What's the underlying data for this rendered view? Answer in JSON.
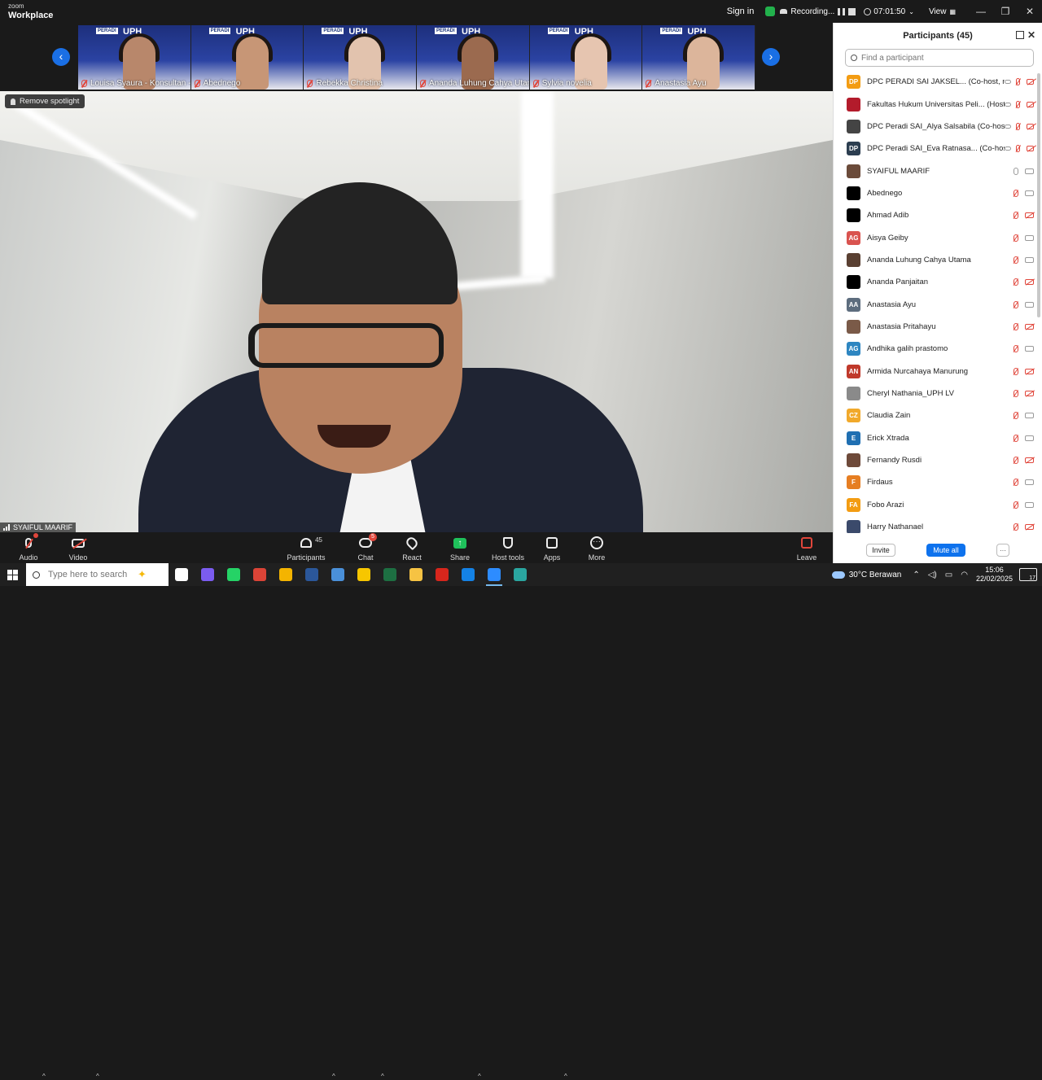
{
  "app": {
    "brand_small": "zoom",
    "brand_name": "Workplace"
  },
  "titlebar": {
    "sign_in": "Sign in",
    "recording": "Recording...",
    "timer": "07:01:50",
    "view": "View",
    "minimize": "—",
    "restore": "❐",
    "close": "✕"
  },
  "thumbnails": [
    {
      "name": "Louisa Syaura - Konsultan -...",
      "logo": "PERADI",
      "org": "UPH",
      "skin": "#b8876b"
    },
    {
      "name": "Abednego",
      "logo": "PERADI",
      "org": "UPH",
      "skin": "#c79676"
    },
    {
      "name": "Rebekka Christina",
      "logo": "PERADI",
      "org": "UPH",
      "skin": "#e2c3ae"
    },
    {
      "name": "Ananda Luhung Cahya Utama",
      "logo": "PERADI",
      "org": "UPH",
      "skin": "#9b6a4f"
    },
    {
      "name": "Sylvia novelia",
      "logo": "PERADI",
      "org": "UPH",
      "skin": "#e6c5b0"
    },
    {
      "name": "Anastasia Ayu",
      "logo": "PERADI",
      "org": "UPH",
      "skin": "#dcb59b"
    }
  ],
  "stage": {
    "remove_spotlight": "Remove spotlight",
    "speaker_name": "SYAIFUL MAARIF"
  },
  "participants": {
    "title": "Participants (45)",
    "search_placeholder": "Find a participant",
    "list": [
      {
        "initials": "DP",
        "color": "#f39c12",
        "name": "DPC PERADI SAI JAKSEL...  (Co-host, me)",
        "cloud": true,
        "mic": "off",
        "cam": "off"
      },
      {
        "initials": "",
        "color": "#b31b2b",
        "name": "Fakultas Hukum Universitas Peli...  (Host)",
        "cloud": true,
        "mic": "off",
        "cam": "off"
      },
      {
        "initials": "",
        "color": "#444444",
        "name": "DPC Peradi SAI_Alya Salsabila (Co-host)",
        "cloud": true,
        "mic": "off",
        "cam": "off"
      },
      {
        "initials": "DP",
        "color": "#2c3e50",
        "name": "DPC Peradi SAI_Eva Ratnasa... (Co-host)",
        "cloud": true,
        "mic": "off",
        "cam": "off"
      },
      {
        "initials": "",
        "color": "#6b4b3a",
        "name": "SYAIFUL MAARIF",
        "cloud": false,
        "mic": "on",
        "cam": "on"
      },
      {
        "initials": "",
        "color": "#000000",
        "name": "Abednego",
        "cloud": false,
        "mic": "off",
        "cam": "on"
      },
      {
        "initials": "",
        "color": "#000000",
        "name": "Ahmad Adib",
        "cloud": false,
        "mic": "off",
        "cam": "off"
      },
      {
        "initials": "AG",
        "color": "#d9534f",
        "name": "Aisya Geiby",
        "cloud": false,
        "mic": "off",
        "cam": "on"
      },
      {
        "initials": "",
        "color": "#5a4032",
        "name": "Ananda Luhung Cahya Utama",
        "cloud": false,
        "mic": "off",
        "cam": "on"
      },
      {
        "initials": "",
        "color": "#000000",
        "name": "Ananda Panjaitan",
        "cloud": false,
        "mic": "off",
        "cam": "off"
      },
      {
        "initials": "AA",
        "color": "#5d6d7e",
        "name": "Anastasia Ayu",
        "cloud": false,
        "mic": "off",
        "cam": "on"
      },
      {
        "initials": "",
        "color": "#7a5a48",
        "name": "Anastasia Pritahayu",
        "cloud": false,
        "mic": "off",
        "cam": "off"
      },
      {
        "initials": "AG",
        "color": "#2e86c1",
        "name": "Andhika galih prastomo",
        "cloud": false,
        "mic": "off",
        "cam": "on"
      },
      {
        "initials": "AN",
        "color": "#c0392b",
        "name": "Armida Nurcahaya Manurung",
        "cloud": false,
        "mic": "off",
        "cam": "off"
      },
      {
        "initials": "",
        "color": "#8a8a8a",
        "name": "Cheryl Nathania_UPH LV",
        "cloud": false,
        "mic": "off",
        "cam": "off"
      },
      {
        "initials": "CZ",
        "color": "#f1a92b",
        "name": "Claudia Zain",
        "cloud": false,
        "mic": "off",
        "cam": "on"
      },
      {
        "initials": "E",
        "color": "#1f6fb2",
        "name": "Erick Xtrada",
        "cloud": false,
        "mic": "off",
        "cam": "on"
      },
      {
        "initials": "",
        "color": "#6e4a3a",
        "name": "Fernandy Rusdi",
        "cloud": false,
        "mic": "off",
        "cam": "off"
      },
      {
        "initials": "F",
        "color": "#e67e22",
        "name": "Firdaus",
        "cloud": false,
        "mic": "off",
        "cam": "on"
      },
      {
        "initials": "FA",
        "color": "#f39c12",
        "name": "Fobo Arazi",
        "cloud": false,
        "mic": "off",
        "cam": "on"
      },
      {
        "initials": "",
        "color": "#3b4a6b",
        "name": "Harry Nathanael",
        "cloud": false,
        "mic": "off",
        "cam": "off"
      }
    ],
    "invite": "Invite",
    "mute_all": "Mute all",
    "more": "···"
  },
  "toolbar": {
    "audio": "Audio",
    "video": "Video",
    "participants": "Participants",
    "participants_count": "45",
    "chat": "Chat",
    "chat_badge": "5",
    "react": "React",
    "share": "Share",
    "host_tools": "Host tools",
    "apps": "Apps",
    "more": "More",
    "leave": "Leave"
  },
  "taskbar": {
    "search_placeholder": "Type here to search",
    "weather": "30°C  Berawan",
    "time": "15:06",
    "date": "22/02/2025",
    "notifications": "17",
    "apps": [
      {
        "name": "task-view",
        "color": "#ffffff"
      },
      {
        "name": "copilot",
        "color": "#7b5cf0"
      },
      {
        "name": "whatsapp",
        "color": "#25d366"
      },
      {
        "name": "chrome-profile",
        "color": "#db4437"
      },
      {
        "name": "chrome",
        "color": "#f4b400"
      },
      {
        "name": "app-dark",
        "color": "#2b579a"
      },
      {
        "name": "store",
        "color": "#4a90d9"
      },
      {
        "name": "sticky-notes",
        "color": "#f7c600"
      },
      {
        "name": "excel",
        "color": "#1d6f42"
      },
      {
        "name": "file-explorer",
        "color": "#f6c343"
      },
      {
        "name": "acrobat",
        "color": "#d7261c"
      },
      {
        "name": "edge",
        "color": "#1482e5"
      },
      {
        "name": "zoom",
        "color": "#2d8cff"
      },
      {
        "name": "edge-beta",
        "color": "#2aa6a0"
      }
    ]
  }
}
